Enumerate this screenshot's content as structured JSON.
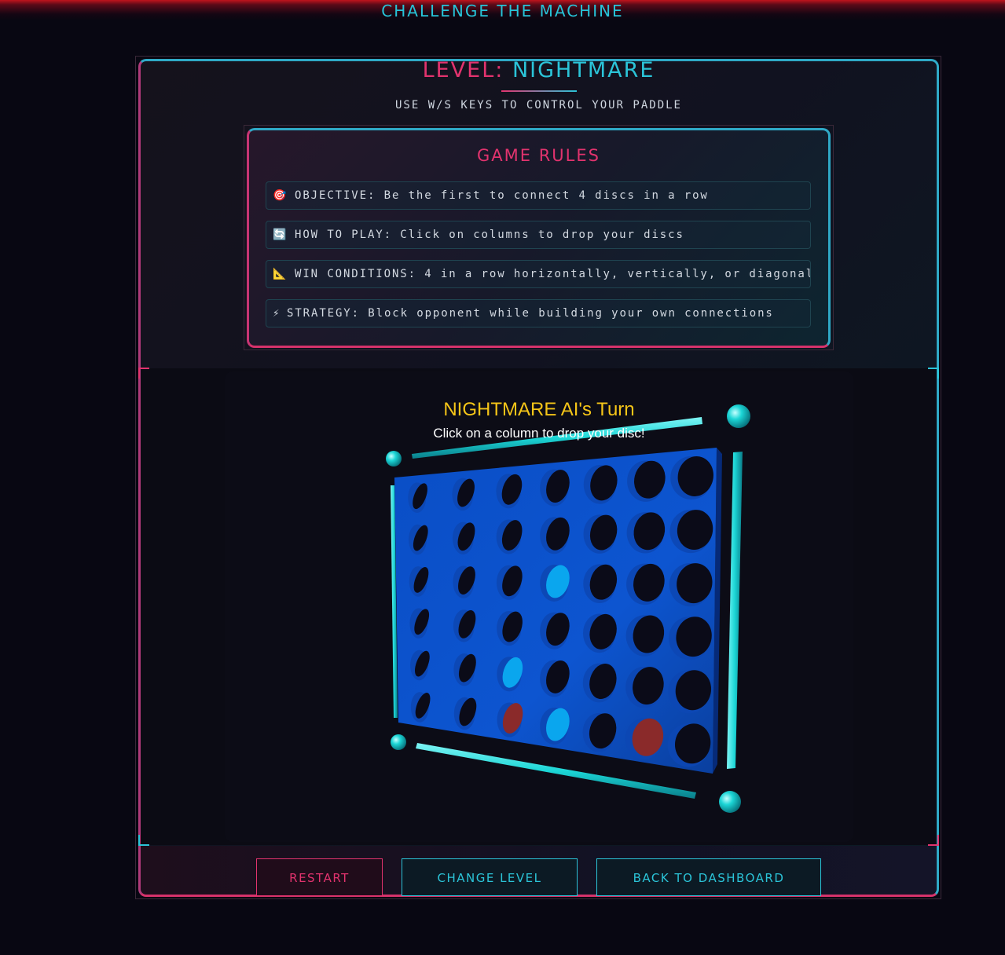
{
  "page": {
    "heading": "CHALLENGE THE MACHINE"
  },
  "level": {
    "label": "LEVEL:",
    "value": "NIGHTMARE",
    "hint": "USE W/S KEYS TO CONTROL YOUR PADDLE"
  },
  "rules": {
    "title": "GAME RULES",
    "items": [
      {
        "icon": "🎯",
        "icon_name": "target-icon",
        "text": "OBJECTIVE: Be the first to connect 4 discs in a row"
      },
      {
        "icon": "🔄",
        "icon_name": "cycle-icon",
        "text": "HOW TO PLAY: Click on columns to drop your discs"
      },
      {
        "icon": "📐",
        "icon_name": "triangle-ruler-icon",
        "text": "WIN CONDITIONS: 4 in a row horizontally, vertically, or diagonally"
      },
      {
        "icon": "⚡",
        "icon_name": "lightning-icon",
        "text": "STRATEGY: Block opponent while building your own connections"
      }
    ]
  },
  "game": {
    "turn_title": "NIGHTMARE AI's Turn",
    "turn_subtitle": "Click on a column to drop your disc!",
    "rows": 6,
    "cols": 7,
    "discs": [
      {
        "row": 2,
        "col": 3,
        "player": "blue"
      },
      {
        "row": 4,
        "col": 2,
        "player": "blue"
      },
      {
        "row": 5,
        "col": 2,
        "player": "red"
      },
      {
        "row": 5,
        "col": 3,
        "player": "blue"
      },
      {
        "row": 5,
        "col": 5,
        "player": "red"
      }
    ],
    "colors": {
      "board": "#0b4fc4",
      "board_dark": "#0a3a9a",
      "hole": "#0b0b18",
      "blue_disc": "#0aa6ee",
      "red_disc": "#8a2a2a",
      "rail": "#1cd6d6",
      "turn": "#f5c518"
    }
  },
  "buttons": {
    "restart": "RESTART",
    "change_level": "CHANGE LEVEL",
    "dashboard": "BACK TO DASHBOARD"
  },
  "theme": {
    "pink": "#e2336e",
    "cyan": "#2bc4d8"
  }
}
